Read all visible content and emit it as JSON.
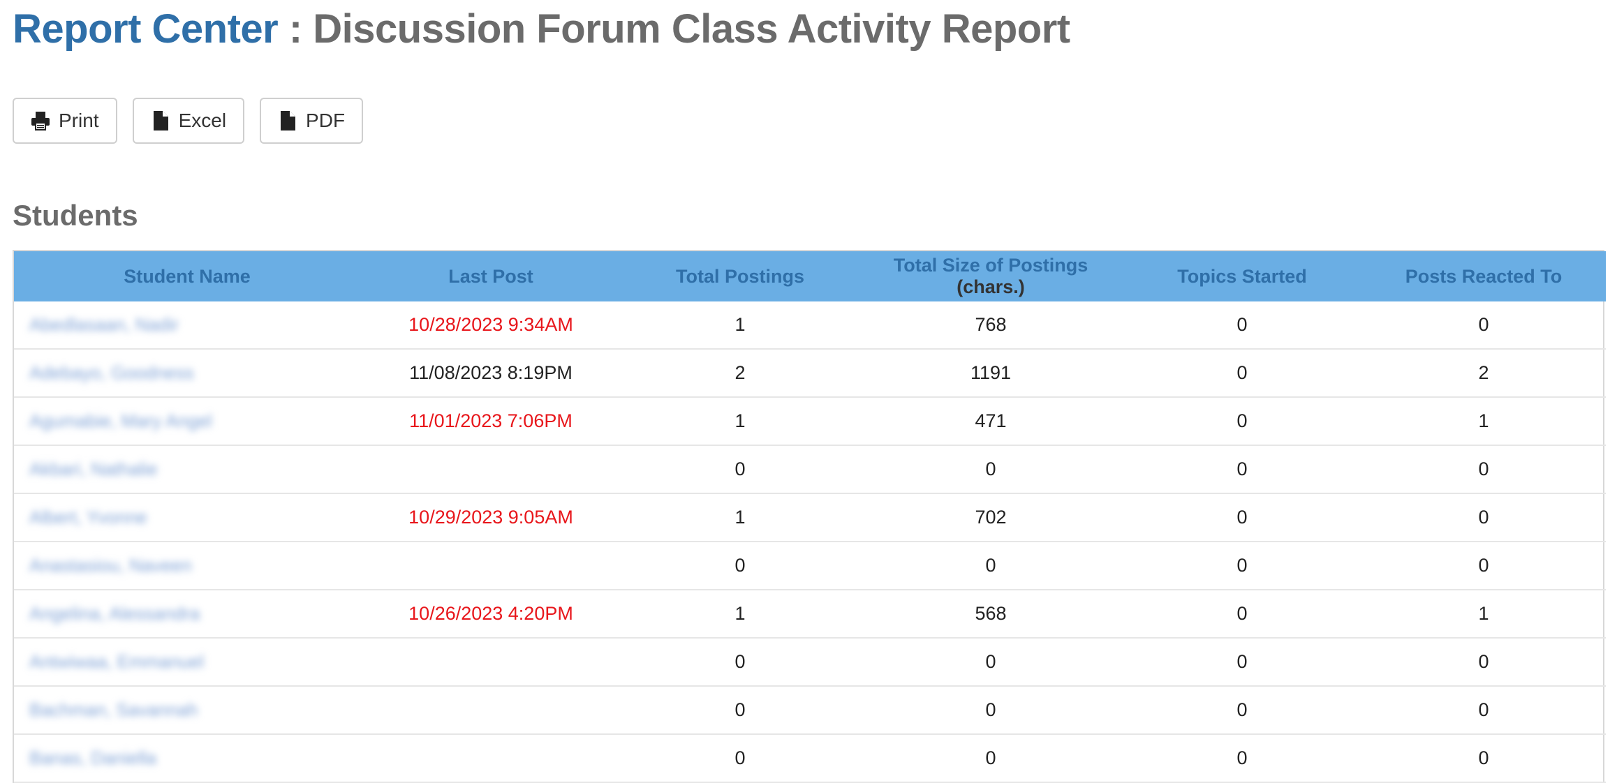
{
  "header": {
    "breadcrumb_link": "Report Center",
    "page_title": " : Discussion Forum Class Activity Report"
  },
  "toolbar": {
    "print_label": "Print",
    "excel_label": "Excel",
    "pdf_label": "PDF"
  },
  "section_title": "Students",
  "table": {
    "headers": {
      "student_name": "Student Name",
      "last_post": "Last Post",
      "total_postings": "Total Postings",
      "total_size": "Total Size of Postings",
      "total_size_unit": "(chars.)",
      "topics_started": "Topics Started",
      "posts_reacted": "Posts Reacted To"
    },
    "rows": [
      {
        "name": "Abedlasaan, Nadir",
        "last_post": "10/28/2023 9:34AM",
        "late": true,
        "postings": "1",
        "size": "768",
        "topics": "0",
        "reacted": "0"
      },
      {
        "name": "Adebayo, Goodness",
        "last_post": "11/08/2023 8:19PM",
        "late": false,
        "postings": "2",
        "size": "1191",
        "topics": "0",
        "reacted": "2"
      },
      {
        "name": "Agumabie, Mary Angel",
        "last_post": "11/01/2023 7:06PM",
        "late": true,
        "postings": "1",
        "size": "471",
        "topics": "0",
        "reacted": "1"
      },
      {
        "name": "Akbari, Nathalie",
        "last_post": "",
        "late": false,
        "postings": "0",
        "size": "0",
        "topics": "0",
        "reacted": "0"
      },
      {
        "name": "Albert, Yvonne",
        "last_post": "10/29/2023 9:05AM",
        "late": true,
        "postings": "1",
        "size": "702",
        "topics": "0",
        "reacted": "0"
      },
      {
        "name": "Anastasiou, Naveen",
        "last_post": "",
        "late": false,
        "postings": "0",
        "size": "0",
        "topics": "0",
        "reacted": "0"
      },
      {
        "name": "Angelina, Alessandra",
        "last_post": "10/26/2023 4:20PM",
        "late": true,
        "postings": "1",
        "size": "568",
        "topics": "0",
        "reacted": "1"
      },
      {
        "name": "Antwiwaa, Emmanuel",
        "last_post": "",
        "late": false,
        "postings": "0",
        "size": "0",
        "topics": "0",
        "reacted": "0"
      },
      {
        "name": "Bachman, Savannah",
        "last_post": "",
        "late": false,
        "postings": "0",
        "size": "0",
        "topics": "0",
        "reacted": "0"
      },
      {
        "name": "Banas, Daniella",
        "last_post": "",
        "late": false,
        "postings": "0",
        "size": "0",
        "topics": "0",
        "reacted": "0"
      }
    ]
  },
  "colors": {
    "header_bg": "#6aaee4",
    "link": "#2f6fa8",
    "late_date": "#e8161b"
  },
  "icons": {
    "print": "printer-icon",
    "excel": "file-icon",
    "pdf": "file-icon"
  }
}
